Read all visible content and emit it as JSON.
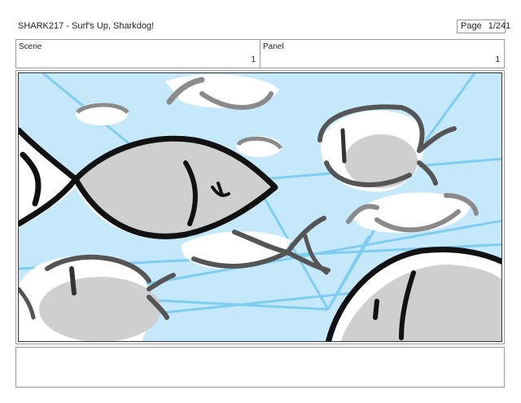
{
  "header": {
    "title": "SHARK217 - Surf's Up, Sharkdog!",
    "page_label": "Page",
    "page_value": "1/241"
  },
  "meta": {
    "scene_label": "Scene",
    "scene_value": "1",
    "panel_label": "Panel",
    "panel_value": "1"
  },
  "colors": {
    "water": "#c6e8fb",
    "ray": "#7fcdf2",
    "fish_fill": "#cfcfcf",
    "outline": "#111111",
    "shadow": "#8a8a8a"
  }
}
